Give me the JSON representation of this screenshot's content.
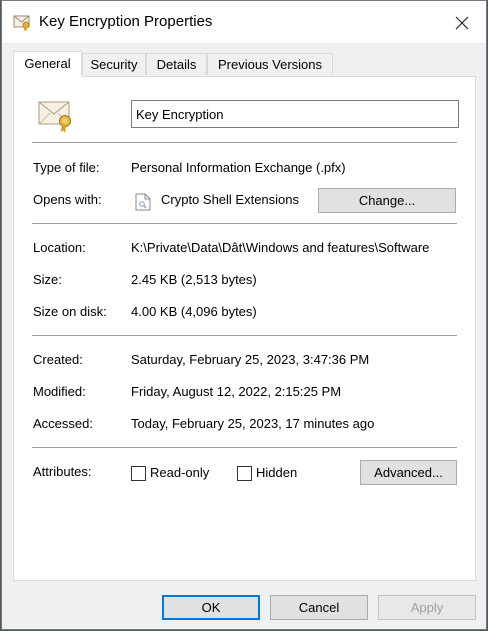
{
  "window": {
    "title": "Key Encryption Properties"
  },
  "tabs": [
    {
      "label": "General"
    },
    {
      "label": "Security"
    },
    {
      "label": "Details"
    },
    {
      "label": "Previous Versions"
    }
  ],
  "general": {
    "file_name": "Key Encryption",
    "type_of_file": {
      "label": "Type of file:",
      "value": "Personal Information Exchange (.pfx)"
    },
    "opens_with": {
      "label": "Opens with:",
      "value": "Crypto Shell Extensions",
      "button": "Change..."
    },
    "location": {
      "label": "Location:",
      "value": "K:\\Private\\Data\\Dât\\Windows and features\\Software"
    },
    "size": {
      "label": "Size:",
      "value": "2.45 KB (2,513 bytes)"
    },
    "size_on_disk": {
      "label": "Size on disk:",
      "value": "4.00 KB (4,096 bytes)"
    },
    "created": {
      "label": "Created:",
      "value": "Saturday, February 25, 2023, 3:47:36 PM"
    },
    "modified": {
      "label": "Modified:",
      "value": "Friday, August 12, 2022, 2:15:25 PM"
    },
    "accessed": {
      "label": "Accessed:",
      "value": "Today, February 25, 2023, 17 minutes ago"
    },
    "attributes": {
      "label": "Attributes:",
      "read_only": {
        "label": "Read-only",
        "checked": false
      },
      "hidden": {
        "label": "Hidden",
        "checked": false
      },
      "advanced_button": "Advanced..."
    }
  },
  "footer": {
    "ok": "OK",
    "cancel": "Cancel",
    "apply": "Apply"
  },
  "colors": {
    "accent": "#0078d7",
    "window_bg": "#f0f0f0",
    "panel_bg": "#ffffff"
  },
  "icons": {
    "title": "certificate-envelope-icon",
    "file": "certificate-envelope-icon",
    "app": "crypto-document-icon",
    "close": "close-icon"
  }
}
